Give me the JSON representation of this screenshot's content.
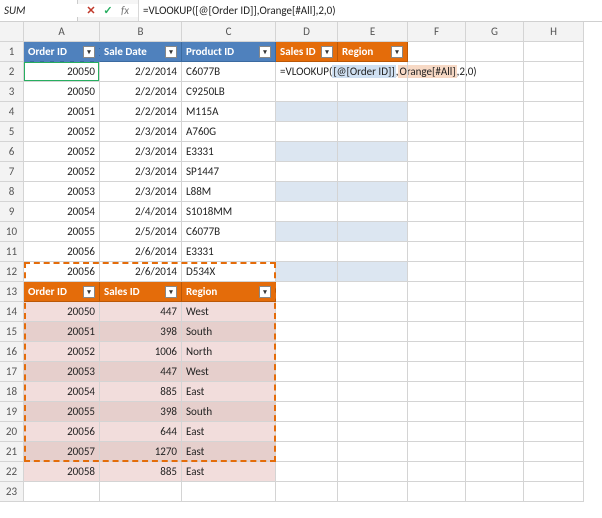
{
  "nameBox": "SUM",
  "formulaBar": "=VLOOKUP([@[Order ID]],Orange[#All],2,0)",
  "editing": {
    "pre": "=VLOOKUP(",
    "ref1": " [@[Order ID]] ",
    "mid": ", ",
    "ref2": "Orange[#All] ",
    "suf": ",2,0)"
  },
  "cols": [
    "A",
    "B",
    "C",
    "D",
    "E",
    "F",
    "G",
    "H"
  ],
  "rows": [
    "1",
    "2",
    "3",
    "4",
    "5",
    "6",
    "7",
    "8",
    "9",
    "10",
    "11",
    "12",
    "13",
    "14",
    "15",
    "16",
    "17",
    "18",
    "19",
    "20",
    "21",
    "22",
    "23"
  ],
  "t1head": [
    "Order ID",
    "Sale Date",
    "Product ID",
    "Sales ID",
    "Region"
  ],
  "t1": [
    {
      "oid": "20050",
      "date": "2/2/2014",
      "pid": "C6077B"
    },
    {
      "oid": "20050",
      "date": "2/2/2014",
      "pid": "C9250LB"
    },
    {
      "oid": "20051",
      "date": "2/2/2014",
      "pid": "M115A"
    },
    {
      "oid": "20052",
      "date": "2/3/2014",
      "pid": "A760G"
    },
    {
      "oid": "20052",
      "date": "2/3/2014",
      "pid": "E3331"
    },
    {
      "oid": "20052",
      "date": "2/3/2014",
      "pid": "SP1447"
    },
    {
      "oid": "20053",
      "date": "2/3/2014",
      "pid": "L88M"
    },
    {
      "oid": "20054",
      "date": "2/4/2014",
      "pid": "S1018MM"
    },
    {
      "oid": "20055",
      "date": "2/5/2014",
      "pid": "C6077B"
    },
    {
      "oid": "20056",
      "date": "2/6/2014",
      "pid": "E3331"
    },
    {
      "oid": "20056",
      "date": "2/6/2014",
      "pid": "D534X"
    }
  ],
  "t2head": [
    "Order ID",
    "Sales ID",
    "Region"
  ],
  "t2": [
    {
      "oid": "20050",
      "sid": "447",
      "reg": "West"
    },
    {
      "oid": "20051",
      "sid": "398",
      "reg": "South"
    },
    {
      "oid": "20052",
      "sid": "1006",
      "reg": "North"
    },
    {
      "oid": "20053",
      "sid": "447",
      "reg": "West"
    },
    {
      "oid": "20054",
      "sid": "885",
      "reg": "East"
    },
    {
      "oid": "20055",
      "sid": "398",
      "reg": "South"
    },
    {
      "oid": "20056",
      "sid": "644",
      "reg": "East"
    },
    {
      "oid": "20057",
      "sid": "1270",
      "reg": "East"
    },
    {
      "oid": "20058",
      "sid": "885",
      "reg": "East"
    }
  ],
  "chart_data": {
    "type": "table",
    "tables": [
      {
        "name": "Blue",
        "columns": [
          "Order ID",
          "Sale Date",
          "Product ID",
          "Sales ID",
          "Region"
        ],
        "rows": [
          [
            "20050",
            "2/2/2014",
            "C6077B",
            "",
            ""
          ],
          [
            "20050",
            "2/2/2014",
            "C9250LB",
            "",
            ""
          ],
          [
            "20051",
            "2/2/2014",
            "M115A",
            "",
            ""
          ],
          [
            "20052",
            "2/3/2014",
            "A760G",
            "",
            ""
          ],
          [
            "20052",
            "2/3/2014",
            "E3331",
            "",
            ""
          ],
          [
            "20052",
            "2/3/2014",
            "SP1447",
            "",
            ""
          ],
          [
            "20053",
            "2/3/2014",
            "L88M",
            "",
            ""
          ],
          [
            "20054",
            "2/4/2014",
            "S1018MM",
            "",
            ""
          ],
          [
            "20055",
            "2/5/2014",
            "C6077B",
            "",
            ""
          ],
          [
            "20056",
            "2/6/2014",
            "E3331",
            "",
            ""
          ],
          [
            "20056",
            "2/6/2014",
            "D534X",
            "",
            ""
          ]
        ]
      },
      {
        "name": "Orange",
        "columns": [
          "Order ID",
          "Sales ID",
          "Region"
        ],
        "rows": [
          [
            "20050",
            "447",
            "West"
          ],
          [
            "20051",
            "398",
            "South"
          ],
          [
            "20052",
            "1006",
            "North"
          ],
          [
            "20053",
            "447",
            "West"
          ],
          [
            "20054",
            "885",
            "East"
          ],
          [
            "20055",
            "398",
            "South"
          ],
          [
            "20056",
            "644",
            "East"
          ],
          [
            "20057",
            "1270",
            "East"
          ],
          [
            "20058",
            "885",
            "East"
          ]
        ]
      }
    ]
  }
}
